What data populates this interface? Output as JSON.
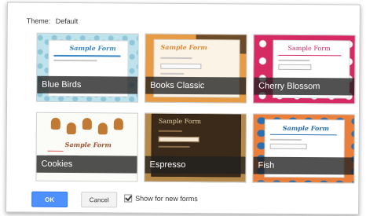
{
  "header": {
    "theme_label": "Theme:",
    "theme_value": "Default"
  },
  "themes": [
    {
      "label": "Blue Birds",
      "preview_title": "Sample Form"
    },
    {
      "label": "Books Classic",
      "preview_title": "Sample Form"
    },
    {
      "label": "Cherry Blossom",
      "preview_title": "Sample Form"
    },
    {
      "label": "Cookies",
      "preview_title": "Sample Form"
    },
    {
      "label": "Espresso",
      "preview_title": "Sample Form"
    },
    {
      "label": "Fish",
      "preview_title": "Sample Form"
    }
  ],
  "footer": {
    "ok_label": "OK",
    "cancel_label": "Cancel",
    "checkbox_label": "Show for new forms",
    "checkbox_checked": true
  },
  "colors": {
    "ok_button": "#4d90fe"
  }
}
